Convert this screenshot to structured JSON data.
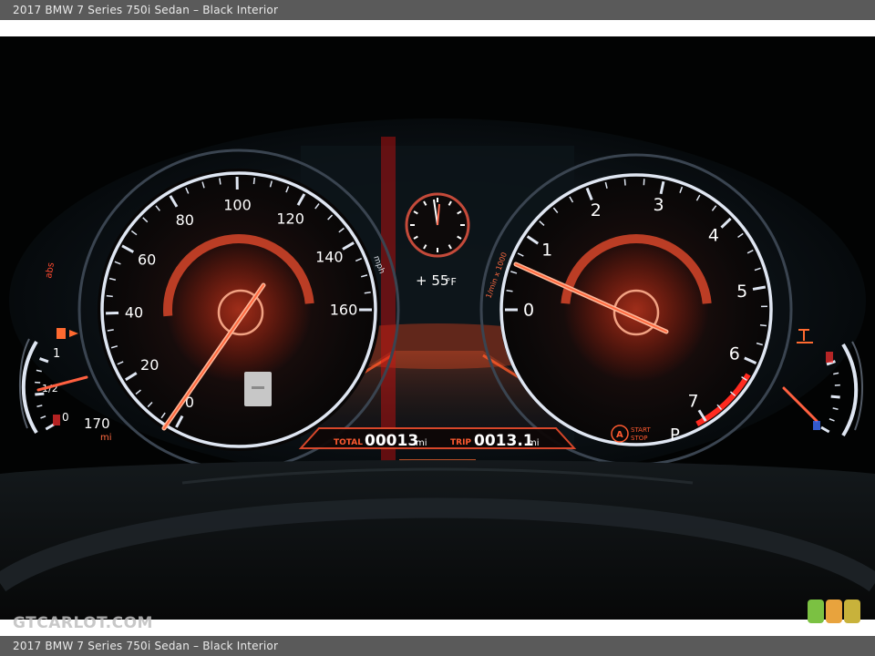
{
  "caption": "2017 BMW 7 Series 750i Sedan – Black Interior",
  "watermark": "GTCARLOT.COM",
  "speedometer": {
    "labels": [
      "0",
      "20",
      "40",
      "60",
      "80",
      "100",
      "120",
      "140",
      "160"
    ],
    "unit": "mph"
  },
  "tachometer": {
    "labels": [
      "0",
      "1",
      "2",
      "3",
      "4",
      "5",
      "6",
      "7"
    ],
    "unit": "1/min x 1000"
  },
  "fuel": {
    "labels": [
      "0",
      "1/2",
      "1"
    ],
    "range_value": "170",
    "range_unit": "mi"
  },
  "temperature": "+ 55",
  "temperature_unit": "°F",
  "total_label": "TOTAL",
  "total_value": "00013",
  "total_unit": "mi",
  "trip_label": "TRIP",
  "trip_value": "0013.1",
  "trip_unit": "mi",
  "start_stop": [
    "START",
    "STOP"
  ],
  "gear": "P",
  "warning_text": "abs",
  "colors": {
    "accent": "#ff5a2a",
    "gauge_ring": "#dfe6f2",
    "logo": [
      "#7bc142",
      "#e8a33d",
      "#c8b23b"
    ]
  }
}
